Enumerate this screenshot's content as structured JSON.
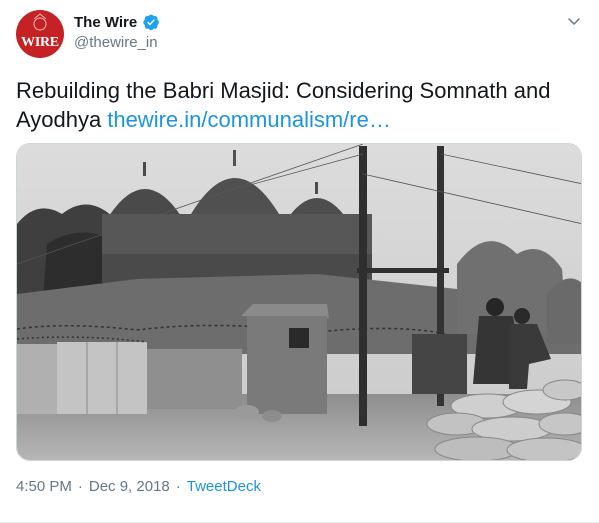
{
  "account": {
    "avatar_text": "WIRE",
    "name": "The Wire",
    "handle": "@thewire_in",
    "brand_color": "#c52225",
    "verified_color": "#1da1f2"
  },
  "tweet": {
    "text": "Rebuilding the Babri Masjid: Considering Somnath and Ayodhya",
    "link": "thewire.in/communalism/re…",
    "time": "4:50 PM",
    "separator": "·",
    "date": "Dec 9, 2018",
    "source": "TweetDeck"
  },
  "icons": {
    "menu": "chevron-down-icon",
    "verified": "verified-badge-icon"
  }
}
